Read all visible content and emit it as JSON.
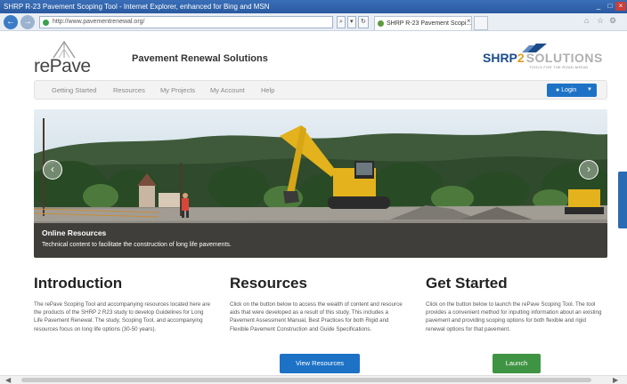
{
  "browser": {
    "title": "SHRP R-23 Pavement Scoping Tool - Internet Explorer, enhanced for Bing and MSN",
    "url": "http://www.pavementrenewal.org/",
    "tab_label": "SHRP R-23 Pavement Scopi...",
    "search_glyph": "⌕",
    "dropdown_glyph": "▾",
    "refresh_glyph": "↻",
    "close_tab_glyph": "×",
    "window_controls": [
      "_",
      "□",
      "×"
    ],
    "right_icons": [
      "⌂",
      "☆",
      "⚙"
    ]
  },
  "header": {
    "logo_text": "rePave",
    "site_name": "Pavement Renewal Solutions",
    "brand_logo": {
      "shrp": "SHRP",
      "two": "2",
      "solutions": "SOLUTIONS",
      "tagline": "TOOLS FOR THE ROAD AHEAD"
    }
  },
  "nav": {
    "items": [
      "Getting Started",
      "Resources",
      "My Projects",
      "My Account",
      "Help"
    ],
    "login_label": "Login",
    "login_icon": "user-icon"
  },
  "hero": {
    "title": "Online Resources",
    "subtitle": "Technical content to facilitate the construction of long life pavements.",
    "prev_glyph": "‹",
    "next_glyph": "›"
  },
  "sections": [
    {
      "heading": "Introduction",
      "text": "The rePave Scoping Tool and accompanying resources located here are the products of the SHRP 2 R23 study to develop Guidelines for Long Life Pavement Renewal. The study, Scoping Tool, and accompanying resources focus on long life options (30-50 years)."
    },
    {
      "heading": "Resources",
      "text": "Click on the button below to access the wealth of content and resource aids that were developed as a result of this study. This includes a Pavement Assessment Manual, Best Practices for both Rigid and Flexible Pavement Construction and Guide Specifications.",
      "button": "View Resources"
    },
    {
      "heading": "Get Started",
      "text": "Click on the button below to launch the rePave Scoping Tool. The tool provides a convenient method for inputting information about an existing pavement and providing scoping options for both flexible and rigid renewal options for that pavement.",
      "button": "Launch"
    }
  ],
  "colors": {
    "primary": "#1d72c6",
    "success": "#3f9443",
    "brand_blue": "#1b4c8a",
    "brand_orange": "#e49b1e"
  }
}
